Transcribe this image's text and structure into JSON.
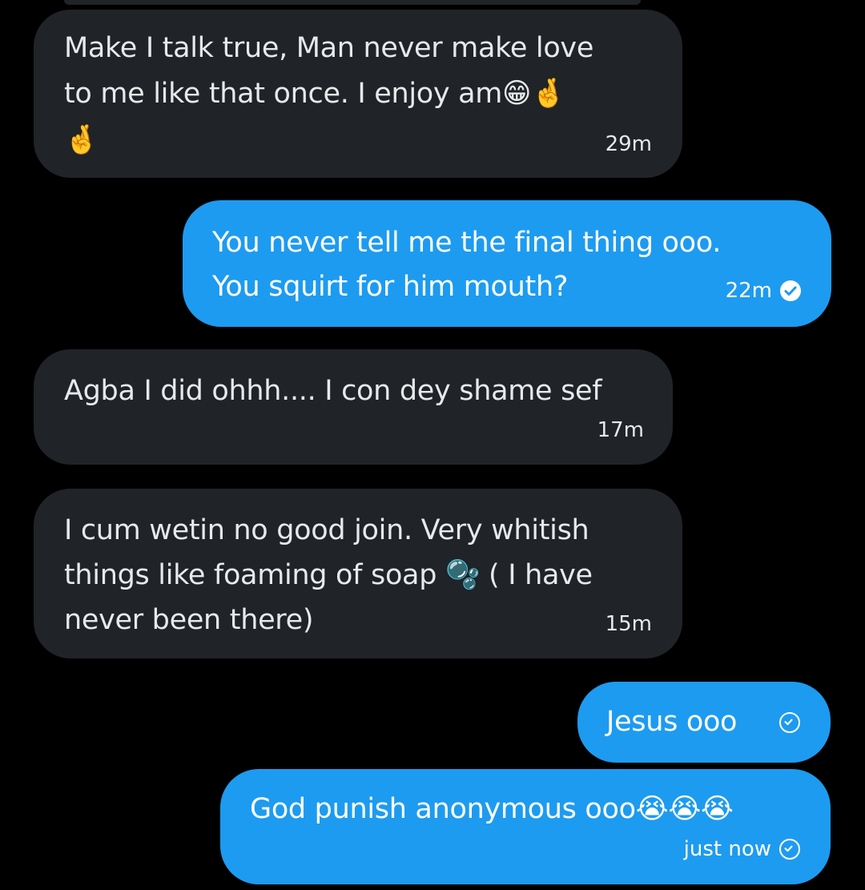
{
  "colors": {
    "background": "#000000",
    "incoming_bubble": "#202327",
    "outgoing_bubble": "#1d9bf0",
    "incoming_text": "#e7e9ea",
    "outgoing_text": "#ffffff"
  },
  "messages": [
    {
      "direction": "incoming",
      "text_line1": "Make I talk true, Man never make love",
      "text_line2": "to me like that once. I enjoy am😁🤞",
      "text_line3": "🤞",
      "time": "29m"
    },
    {
      "direction": "outgoing",
      "text_line1": "You never tell me the final thing ooo.",
      "text_line2": "You squirt for him mouth?",
      "time": "22m",
      "status_icon": "seen-check-icon"
    },
    {
      "direction": "incoming",
      "text_line1": "Agba I did ohhh.... I con dey shame sef",
      "time": "17m"
    },
    {
      "direction": "incoming",
      "text_line1": "I cum wetin no good join. Very whitish",
      "text_line2": "things like foaming of soap 🫧 ( I have",
      "text_line3": "never been there)",
      "time": "15m"
    },
    {
      "direction": "outgoing",
      "text_line1": "Jesus ooo",
      "status_icon": "sent-check-icon"
    },
    {
      "direction": "outgoing",
      "text_line1": "God punish anonymous ooo😭😭😭",
      "time": "just now",
      "status_icon": "sent-check-icon"
    }
  ]
}
